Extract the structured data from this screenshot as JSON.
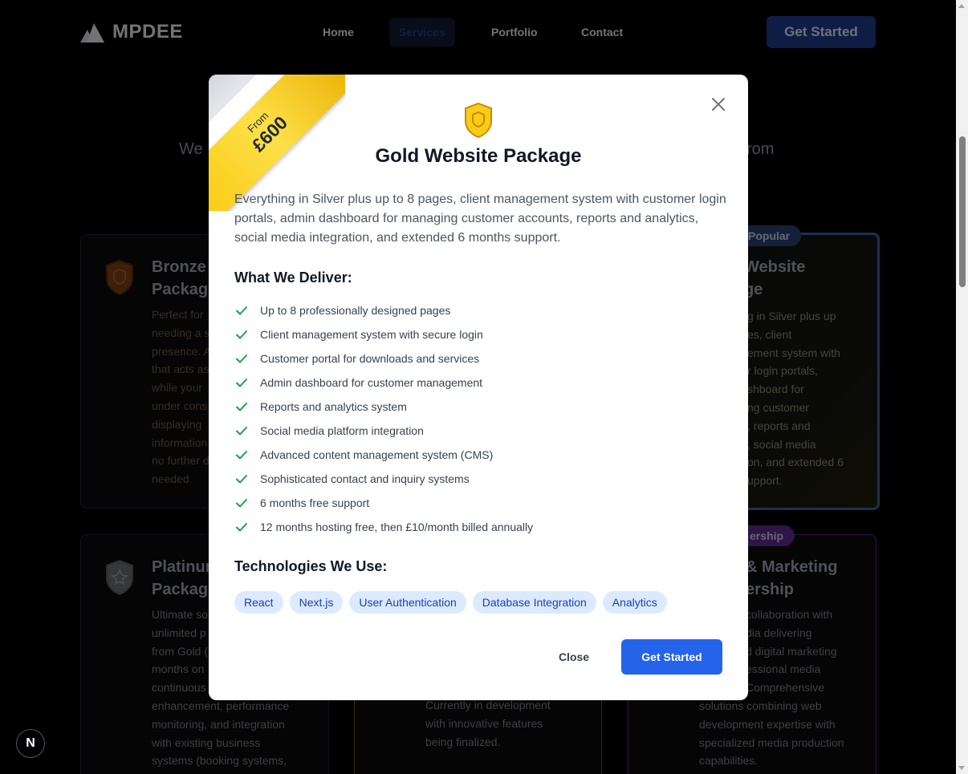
{
  "nav": {
    "brand": "MPDEE",
    "links": [
      "Home",
      "Services",
      "Portfolio",
      "Contact"
    ],
    "active": "Services",
    "cta": "Get Started"
  },
  "background": {
    "subtitle_left_fragment": "We",
    "subtitle_right_fragment": "rom",
    "bronze": {
      "title": [
        "Bronze",
        "Packag"
      ],
      "text": [
        "Perfect for",
        "needing a s",
        "presence. A",
        "that acts as",
        "while your",
        "under cons",
        "displaying",
        "information",
        "no further d",
        "needed."
      ]
    },
    "gold": {
      "badge": "Popular",
      "title": [
        "Website",
        "ge"
      ],
      "text": [
        "g in Silver plus up",
        "es, client",
        "ement system with",
        "r login portals,",
        "shboard for",
        "ng customer",
        ", reports and",
        ", social media",
        "on, and extended 6",
        "upport."
      ]
    },
    "platinum": {
      "title": [
        "Platinum",
        "Packag"
      ],
      "text": [
        "Ultimate so",
        "unlimited p",
        "from Gold (",
        "months on",
        "continuous",
        "enhancement, performance",
        "monitoring, and integration",
        "with existing business",
        "systems (booking systems,"
      ]
    },
    "dev": {
      "text": [
        "Currently in development",
        "with innovative features",
        "being finalized."
      ]
    },
    "media": {
      "badge": "ership",
      "title": [
        "& Marketing",
        "ership"
      ],
      "text": [
        "collaboration with",
        "dia delivering",
        "d digital marketing",
        "essional media",
        "Comprehensive",
        "solutions combining web",
        "development expertise with",
        "specialized media production",
        "capabilities."
      ]
    },
    "devtools_badge": "N"
  },
  "modal": {
    "ribbon_from": "From",
    "ribbon_price": "£600",
    "title": "Gold Website Package",
    "description": "Everything in Silver plus up to 8 pages, client management system with customer login portals, admin dashboard for managing customer accounts, reports and analytics, social media integration, and extended 6 months support.",
    "deliver_heading": "What We Deliver:",
    "deliverables": [
      "Up to 8 professionally designed pages",
      "Client management system with secure login",
      "Customer portal for downloads and services",
      "Admin dashboard for customer management",
      "Reports and analytics system",
      "Social media platform integration",
      "Advanced content management system (CMS)",
      "Sophisticated contact and inquiry systems",
      "6 months free support",
      "12 months hosting free, then £10/month billed annually"
    ],
    "tech_heading": "Technologies We Use:",
    "technologies": [
      "React",
      "Next.js",
      "User Authentication",
      "Database Integration",
      "Analytics"
    ],
    "close_label": "Close",
    "start_label": "Get Started"
  },
  "colors": {
    "gold": "#facc15",
    "bronze": "#8b4a1c",
    "primary": "#2563eb",
    "check": "#16a34a",
    "tag_bg": "#dbeafe",
    "tag_text": "#1e40af"
  },
  "icons": {
    "logo": "triangle-mountains-icon",
    "modal_close": "close-icon",
    "tier": "shield-icon",
    "check": "check-icon"
  }
}
